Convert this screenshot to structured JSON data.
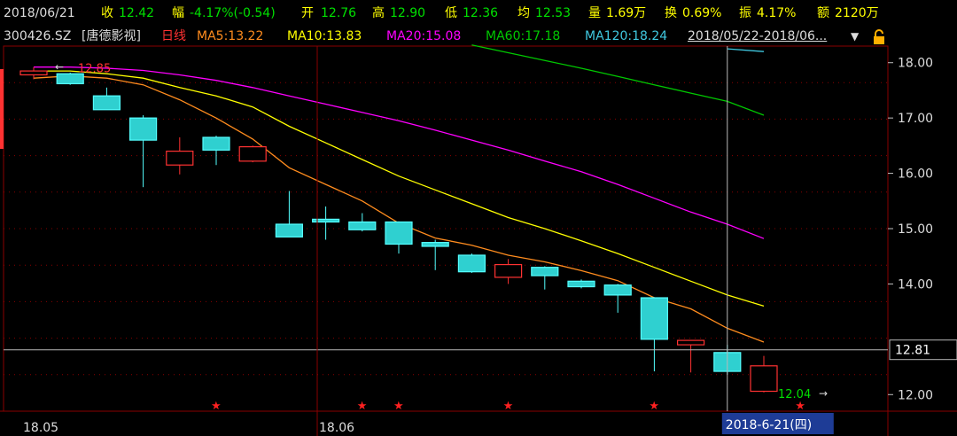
{
  "quote": {
    "date": "2018/06/21",
    "close_label": "收",
    "close_value": "12.42",
    "change_label": "幅",
    "change_value": "-4.17%(-0.54)",
    "open_label": "开",
    "open_value": "12.76",
    "high_label": "高",
    "high_value": "12.90",
    "low_label": "低",
    "low_value": "12.36",
    "avg_label": "均",
    "avg_value": "12.53",
    "volume_label": "量",
    "volume_value": "1.69万",
    "turnover_label": "换",
    "turnover_value": "0.69%",
    "amplitude_label": "振",
    "amplitude_value": "4.17%",
    "amount_label": "额",
    "amount_value": "2120万"
  },
  "ma_bar": {
    "symbol": "300426.SZ",
    "name": "[唐德影视]",
    "period": "日线",
    "ma5": "MA5:13.22",
    "ma10": "MA10:13.83",
    "ma20": "MA20:15.08",
    "ma60": "MA60:17.18",
    "ma120": "MA120:18.24",
    "range": "2018/05/22-2018/06...",
    "dropdown_icon": "triangle-down-icon",
    "lock_icon": "lock-icon"
  },
  "colors": {
    "up": "#ff3232",
    "down": "#54ffff",
    "down_fill": "#2fd0d0",
    "ma5": "#ff8c1e",
    "ma10": "#ffff00",
    "ma20": "#ff00ff",
    "ma60": "#00c800",
    "ma120": "#40c8e0",
    "grid": "#8a0000",
    "axis": "#c0c0c0"
  },
  "chart_data": {
    "type": "candlestick",
    "ylim": [
      11.7,
      18.3
    ],
    "y_ticks": [
      "18.00",
      "17.00",
      "16.00",
      "15.00",
      "14.00",
      "12.00"
    ],
    "crosshair_price": "12.81",
    "cursor_date": "2018-6-21(四)",
    "x_labels": [
      "18.05",
      "18.06"
    ],
    "high_marker": "12.85",
    "low_marker": "12.04",
    "candles": [
      {
        "o": 17.78,
        "h": 17.92,
        "l": 17.7,
        "c": 17.85
      },
      {
        "o": 17.8,
        "h": 17.82,
        "l": 17.6,
        "c": 17.62
      },
      {
        "o": 17.4,
        "h": 17.55,
        "l": 17.15,
        "c": 17.15
      },
      {
        "o": 17.0,
        "h": 17.05,
        "l": 15.75,
        "c": 16.6
      },
      {
        "o": 16.15,
        "h": 16.65,
        "l": 15.98,
        "c": 16.4
      },
      {
        "o": 16.65,
        "h": 16.68,
        "l": 16.15,
        "c": 16.42
      },
      {
        "o": 16.22,
        "h": 16.5,
        "l": 16.2,
        "c": 16.48
      },
      {
        "o": 15.08,
        "h": 15.68,
        "l": 14.85,
        "c": 14.85
      },
      {
        "o": 15.17,
        "h": 15.4,
        "l": 14.8,
        "c": 15.12
      },
      {
        "o": 15.12,
        "h": 15.28,
        "l": 14.95,
        "c": 14.98
      },
      {
        "o": 15.12,
        "h": 15.13,
        "l": 14.55,
        "c": 14.72
      },
      {
        "o": 14.75,
        "h": 14.8,
        "l": 14.25,
        "c": 14.68
      },
      {
        "o": 14.52,
        "h": 14.55,
        "l": 14.2,
        "c": 14.22
      },
      {
        "o": 14.12,
        "h": 14.45,
        "l": 14.0,
        "c": 14.35
      },
      {
        "o": 14.3,
        "h": 14.32,
        "l": 13.9,
        "c": 14.15
      },
      {
        "o": 14.05,
        "h": 14.08,
        "l": 13.92,
        "c": 13.95
      },
      {
        "o": 13.98,
        "h": 14.0,
        "l": 13.48,
        "c": 13.8
      },
      {
        "o": 13.75,
        "h": 13.76,
        "l": 12.42,
        "c": 13.0
      },
      {
        "o": 12.9,
        "h": 12.97,
        "l": 12.4,
        "c": 12.98
      },
      {
        "o": 12.76,
        "h": 12.9,
        "l": 12.36,
        "c": 12.42
      },
      {
        "o": 12.06,
        "h": 12.7,
        "l": 12.04,
        "c": 12.52
      }
    ],
    "series": [
      {
        "name": "MA5",
        "values": [
          17.72,
          17.76,
          17.72,
          17.6,
          17.33,
          17.0,
          16.62,
          16.1,
          15.8,
          15.5,
          15.1,
          14.83,
          14.7,
          14.52,
          14.4,
          14.24,
          14.06,
          13.75,
          13.55,
          13.2,
          12.95
        ]
      },
      {
        "name": "MA10",
        "values": [
          17.85,
          17.85,
          17.8,
          17.72,
          17.55,
          17.4,
          17.2,
          16.85,
          16.55,
          16.25,
          15.95,
          15.7,
          15.45,
          15.2,
          15.0,
          14.78,
          14.55,
          14.3,
          14.05,
          13.8,
          13.6
        ]
      },
      {
        "name": "MA20",
        "values": [
          17.92,
          17.92,
          17.9,
          17.86,
          17.78,
          17.68,
          17.55,
          17.4,
          17.25,
          17.1,
          16.95,
          16.78,
          16.6,
          16.42,
          16.22,
          16.03,
          15.8,
          15.55,
          15.3,
          15.08,
          14.82
        ]
      },
      {
        "name": "MA60",
        "values": [
          null,
          null,
          null,
          null,
          null,
          null,
          null,
          null,
          null,
          null,
          null,
          null,
          18.32,
          18.18,
          18.04,
          17.9,
          17.75,
          17.6,
          17.45,
          17.3,
          17.05
        ]
      },
      {
        "name": "MA120",
        "values": [
          null,
          null,
          null,
          null,
          null,
          null,
          null,
          null,
          null,
          null,
          null,
          null,
          null,
          null,
          null,
          null,
          null,
          null,
          null,
          18.25,
          18.2
        ]
      }
    ],
    "star_indices": [
      5,
      9,
      10,
      13,
      17,
      21
    ]
  }
}
